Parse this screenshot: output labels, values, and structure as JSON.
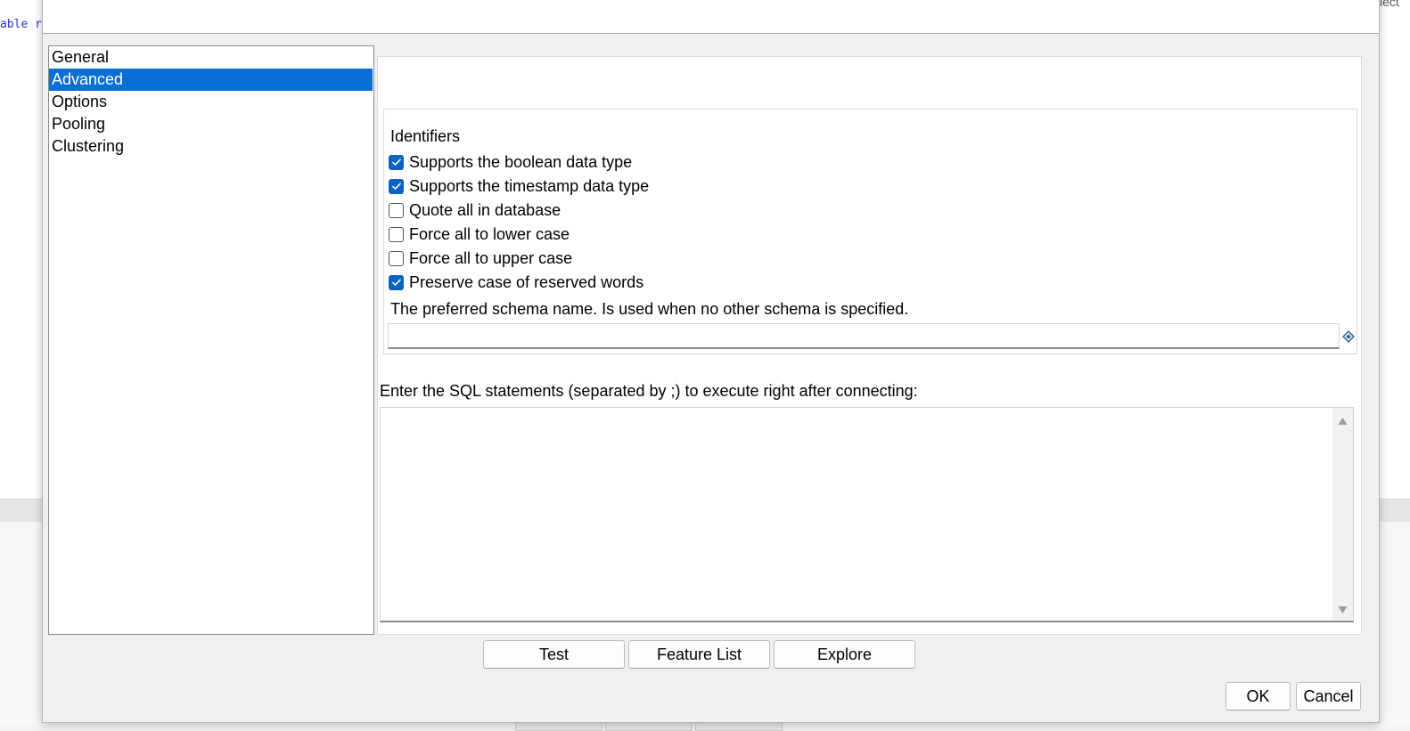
{
  "background": {
    "code_fragment": "able r",
    "right_fragment": "lect"
  },
  "nav": {
    "items": [
      {
        "label": "General",
        "selected": false
      },
      {
        "label": "Advanced",
        "selected": true
      },
      {
        "label": "Options",
        "selected": false
      },
      {
        "label": "Pooling",
        "selected": false
      },
      {
        "label": "Clustering",
        "selected": false
      }
    ]
  },
  "identifiers": {
    "title": "Identifiers",
    "options": [
      {
        "label": "Supports the boolean data type",
        "checked": true
      },
      {
        "label": "Supports the timestamp data type",
        "checked": true
      },
      {
        "label": "Quote all in database",
        "checked": false
      },
      {
        "label": "Force all to lower case",
        "checked": false
      },
      {
        "label": "Force all to upper case",
        "checked": false
      },
      {
        "label": "Preserve case of reserved words",
        "checked": true
      }
    ],
    "schema_label": "The preferred schema name. Is used when no other schema is specified.",
    "schema_value": ""
  },
  "sql": {
    "label": "Enter the SQL statements (separated by ;) to execute right after connecting:",
    "value": ""
  },
  "buttons": {
    "test": "Test",
    "feature_list": "Feature List",
    "explore": "Explore",
    "ok": "OK",
    "cancel": "Cancel"
  },
  "colors": {
    "selection": "#0a6fd4",
    "checkbox_checked": "#0a62c4"
  },
  "icons": {
    "checkbox": "checkmark-icon",
    "schema_input": "diamond-icon",
    "scroll_up": "triangle-up-icon",
    "scroll_down": "triangle-down-icon"
  }
}
